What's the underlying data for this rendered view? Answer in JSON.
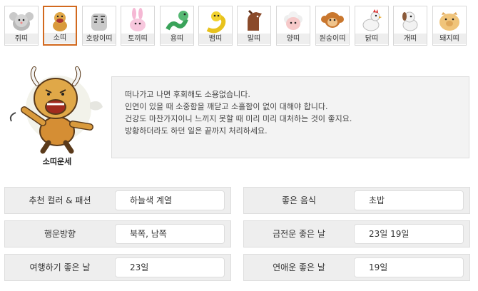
{
  "zodiac_tabs": [
    {
      "label": "쥐띠",
      "icon": "rat-icon",
      "active": false
    },
    {
      "label": "소띠",
      "icon": "ox-icon",
      "active": true
    },
    {
      "label": "호랑이띠",
      "icon": "tiger-icon",
      "active": false
    },
    {
      "label": "토끼띠",
      "icon": "rabbit-icon",
      "active": false
    },
    {
      "label": "용띠",
      "icon": "dragon-icon",
      "active": false
    },
    {
      "label": "뱀띠",
      "icon": "snake-icon",
      "active": false
    },
    {
      "label": "말띠",
      "icon": "horse-icon",
      "active": false
    },
    {
      "label": "양띠",
      "icon": "sheep-icon",
      "active": false
    },
    {
      "label": "원숭이띠",
      "icon": "monkey-icon",
      "active": false
    },
    {
      "label": "닭띠",
      "icon": "rooster-icon",
      "active": false
    },
    {
      "label": "개띠",
      "icon": "dog-icon",
      "active": false
    },
    {
      "label": "돼지띠",
      "icon": "pig-icon",
      "active": false
    }
  ],
  "colors": {
    "active_tab_border": "#d2691e",
    "panel_bg": "#f3f3f3",
    "info_bg": "#eeeeee"
  },
  "fortune": {
    "title": "소띠운세",
    "mascot_icon": "ox-mascot-icon",
    "lines": [
      "떠나가고 나면 후회해도 소용없습니다.",
      "인연이 있을 때 소중함을 깨닫고 소홀함이 없이 대해야 합니다.",
      "건강도 마찬가지이니 느끼지 못할 때 미리 미리 대처하는 것이 좋지요.",
      "방황하더라도 하던 일은 끝까지 처리하세요."
    ]
  },
  "details": [
    {
      "label": "추천 컬러 & 패션",
      "value": "하늘색 계열"
    },
    {
      "label": "좋은 음식",
      "value": "초밥"
    },
    {
      "label": "행운방향",
      "value": "북쪽, 남쪽"
    },
    {
      "label": "금전운 좋은 날",
      "value": "23일 19일"
    },
    {
      "label": "여행하기 좋은 날",
      "value": "23일"
    },
    {
      "label": "연애운 좋은 날",
      "value": "19일"
    }
  ]
}
